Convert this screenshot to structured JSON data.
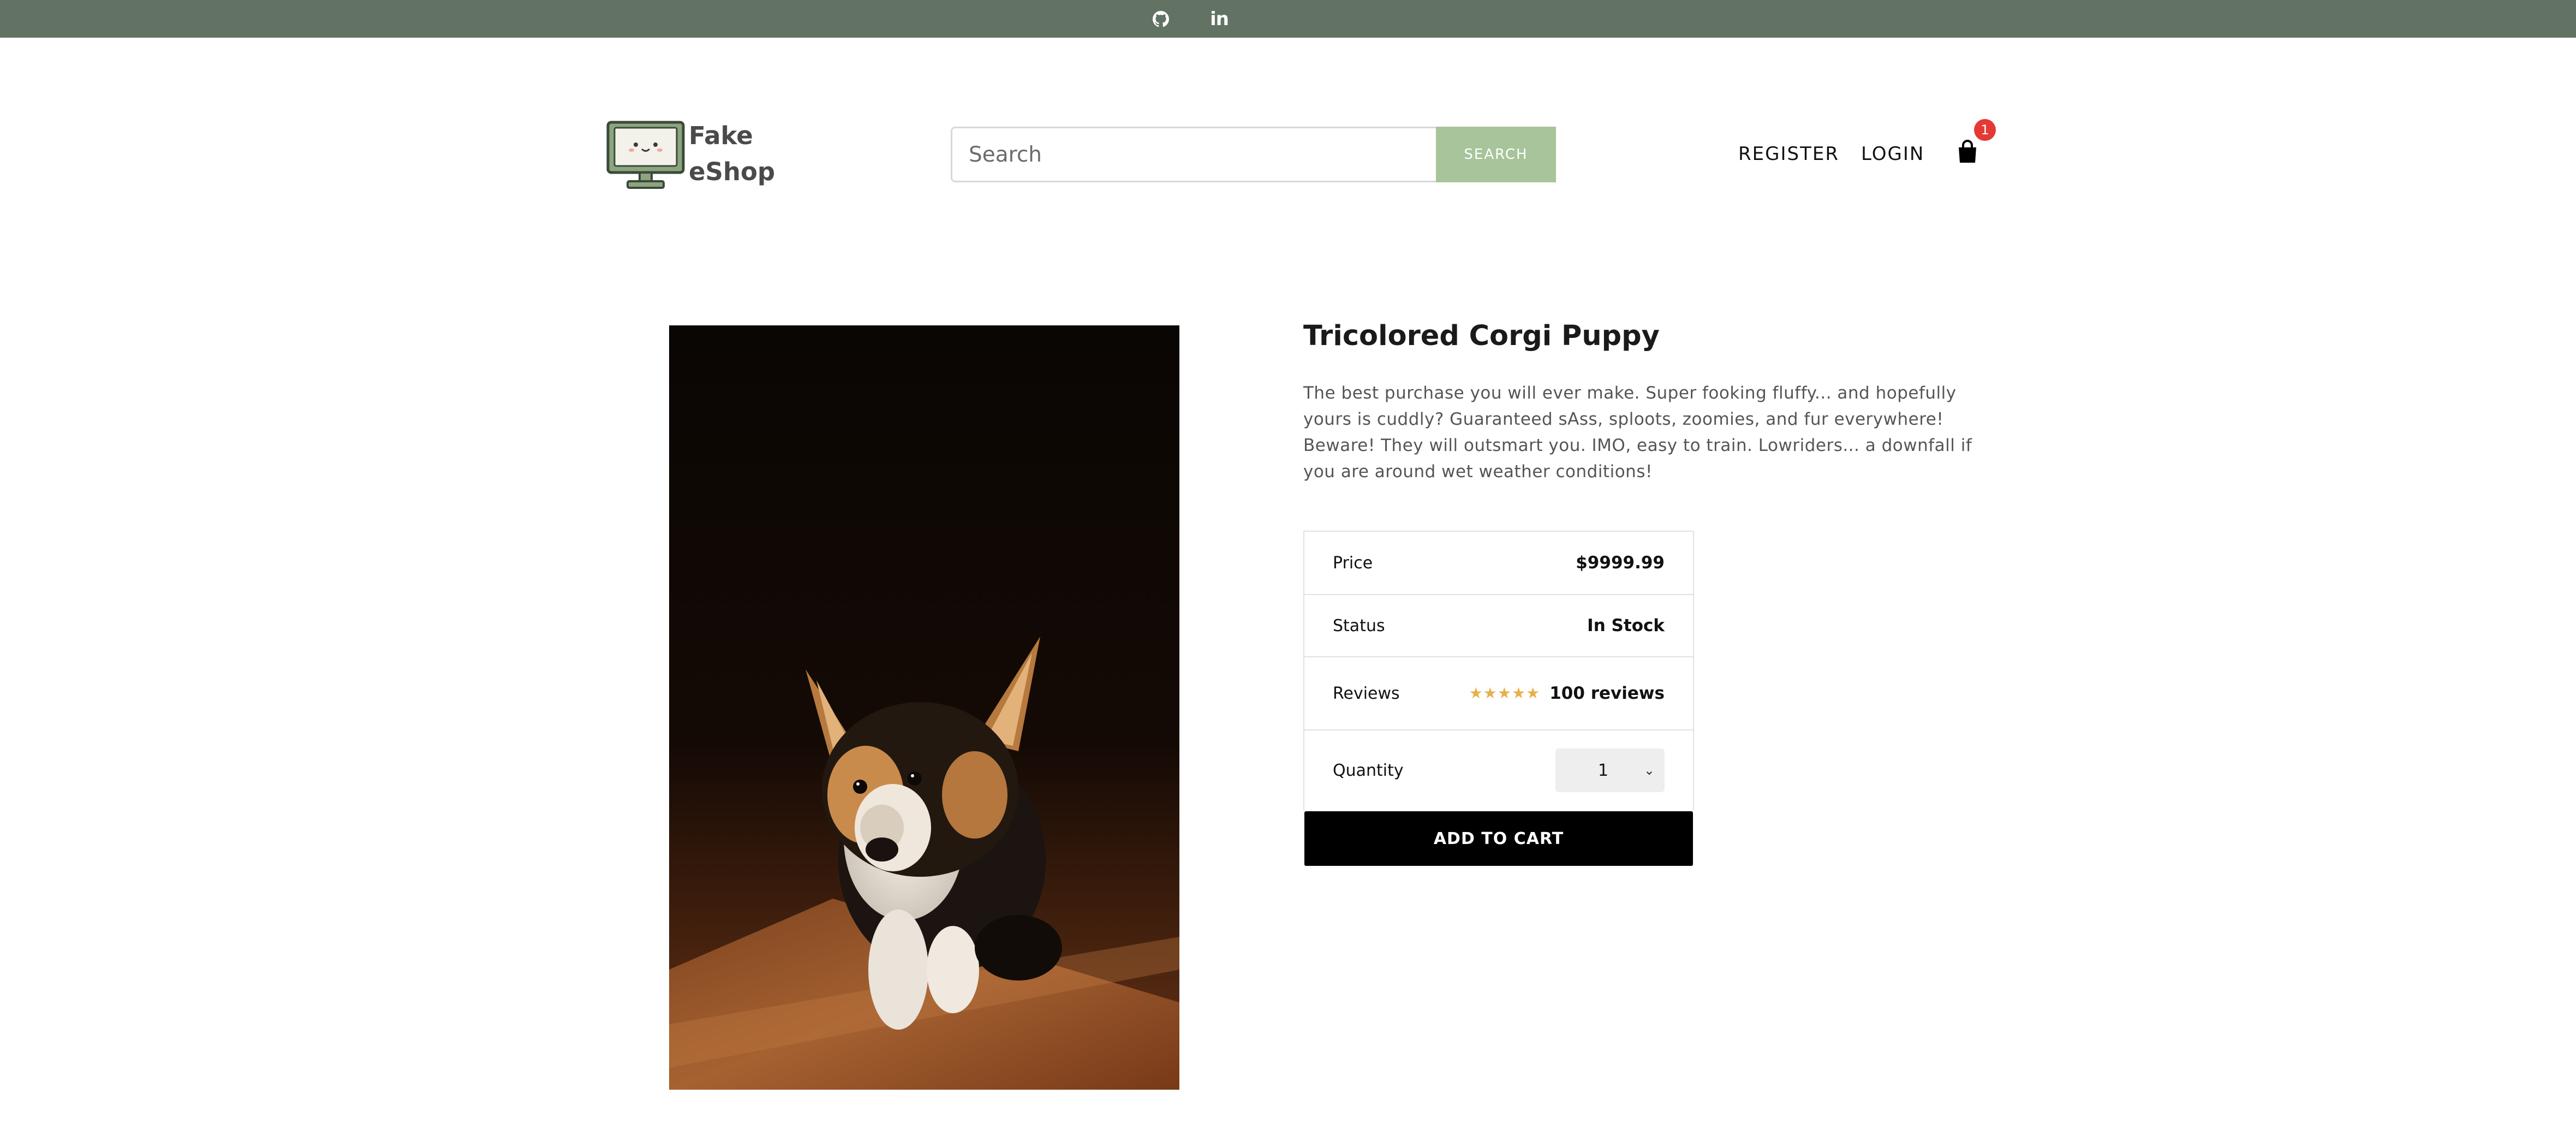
{
  "social": {
    "github_icon": "github-icon",
    "linkedin_icon": "linkedin-icon",
    "linkedin_glyph": "in"
  },
  "header": {
    "brand_line1": "Fake",
    "brand_line2": "eShop",
    "search": {
      "placeholder": "Search",
      "button_label": "SEARCH"
    },
    "register_label": "REGISTER",
    "login_label": "LOGIN",
    "cart_count": "1"
  },
  "product": {
    "title": "Tricolored Corgi Puppy",
    "description": "The best purchase you will ever make. Super fooking fluffy... and hopefully yours is cuddly? Guaranteed sAss, sploots, zoomies, and fur everywhere! Beware! They will outsmart you. IMO, easy to train. Lowriders... a downfall if you are around wet weather conditions!",
    "price_label": "Price",
    "price_value": "$9999.99",
    "status_label": "Status",
    "status_value": "In Stock",
    "reviews_label": "Reviews",
    "rating": 5,
    "reviews_value": "100 reviews",
    "quantity_label": "Quantity",
    "quantity_value": "1",
    "add_to_cart_label": "ADD TO CART"
  },
  "colors": {
    "topbar": "#627263",
    "search_button": "#a7c49b",
    "badge": "#e53935",
    "star": "#e8b04a"
  }
}
